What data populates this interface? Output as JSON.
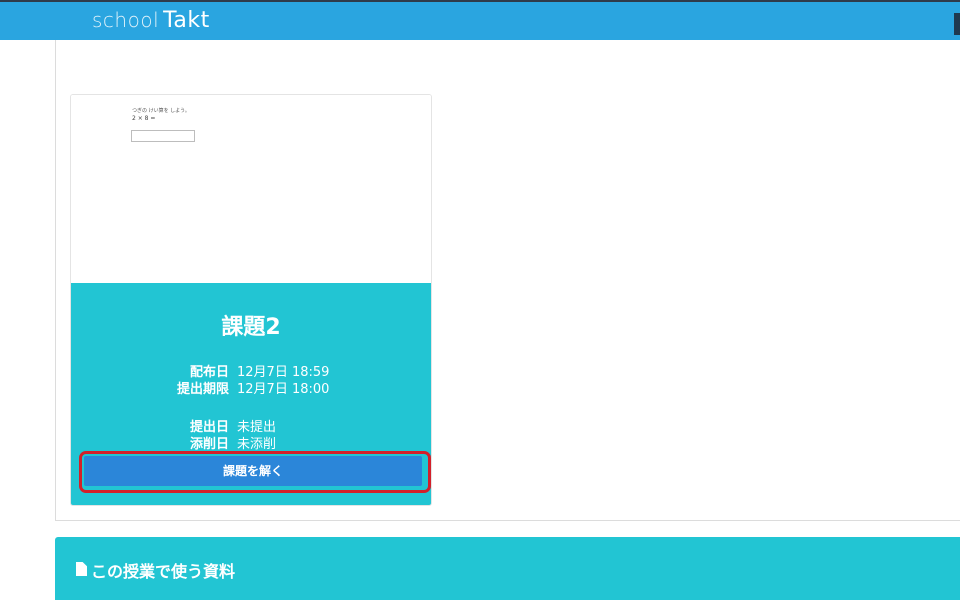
{
  "header": {
    "logo_school": "school",
    "logo_takt": "Takt"
  },
  "assignment_card": {
    "preview": {
      "instruction": "つぎの けい算を しよう。",
      "expression": "2 × 8 ="
    },
    "title": "課題2",
    "distributed_label": "配布日",
    "distributed_value": "12月7日 18:59",
    "deadline_label": "提出期限",
    "deadline_value": "12月7日 18:00",
    "submitted_label": "提出日",
    "submitted_value": "未提出",
    "corrected_label": "添削日",
    "corrected_value": "未添削",
    "solve_button": "課題を解く"
  },
  "materials": {
    "title": "この授業で使う資料"
  },
  "colors": {
    "navbar": "#2aa5e0",
    "card_info": "#22c5d3",
    "solve_button": "#2b86d9",
    "highlight": "#d3202a"
  }
}
